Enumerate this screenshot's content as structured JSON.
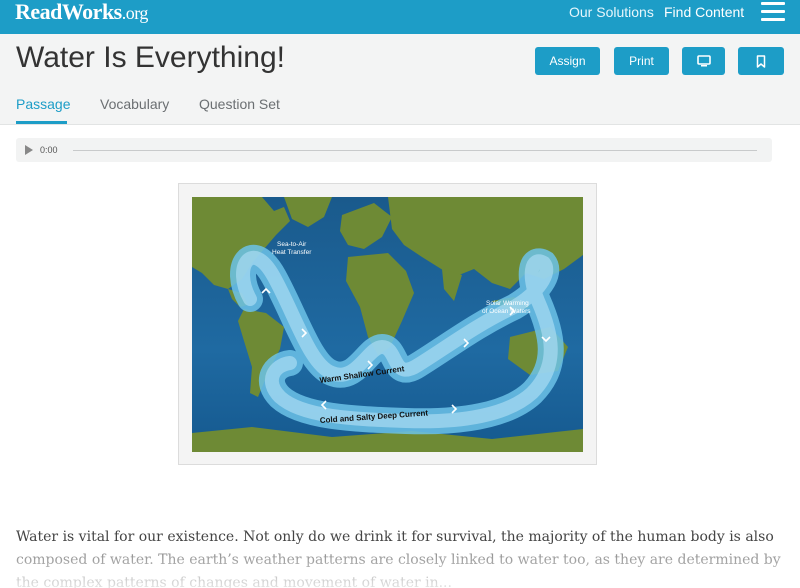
{
  "nav": {
    "logo_main": "ReadWorks",
    "logo_suffix": ".org",
    "our_solutions": "Our Solutions",
    "find_content": "Find Content",
    "menu_icon": "hamburger-menu-icon"
  },
  "header": {
    "title": "Water Is Everything!",
    "buttons": {
      "assign": "Assign",
      "print": "Print",
      "present_icon": "monitor-icon",
      "bookmark_icon": "bookmark-icon"
    },
    "tabs": [
      "Passage",
      "Vocabulary",
      "Question Set"
    ],
    "active_tab": "Passage"
  },
  "audio": {
    "time": "0:00",
    "play_icon": "play-icon"
  },
  "figure": {
    "labels": {
      "sea_to_air_1": "Sea-to-Air",
      "sea_to_air_2": "Heat Transfer",
      "solar_1": "Solar Warming",
      "solar_2": "of Ocean Waters",
      "warm_current": "Warm Shallow Current",
      "cold_current": "Cold and Salty Deep Current"
    }
  },
  "passage": {
    "text": "Water is vital for our existence. Not only do we drink it for survival, the majority of the human body is also composed of water. The earth’s weather patterns are closely linked to water too, as they are determined by the complex patterns of changes and movement of water in..."
  },
  "colors": {
    "brand": "#1d9dc7",
    "ocean": "#1f5f92",
    "land": "#6e8a35"
  }
}
